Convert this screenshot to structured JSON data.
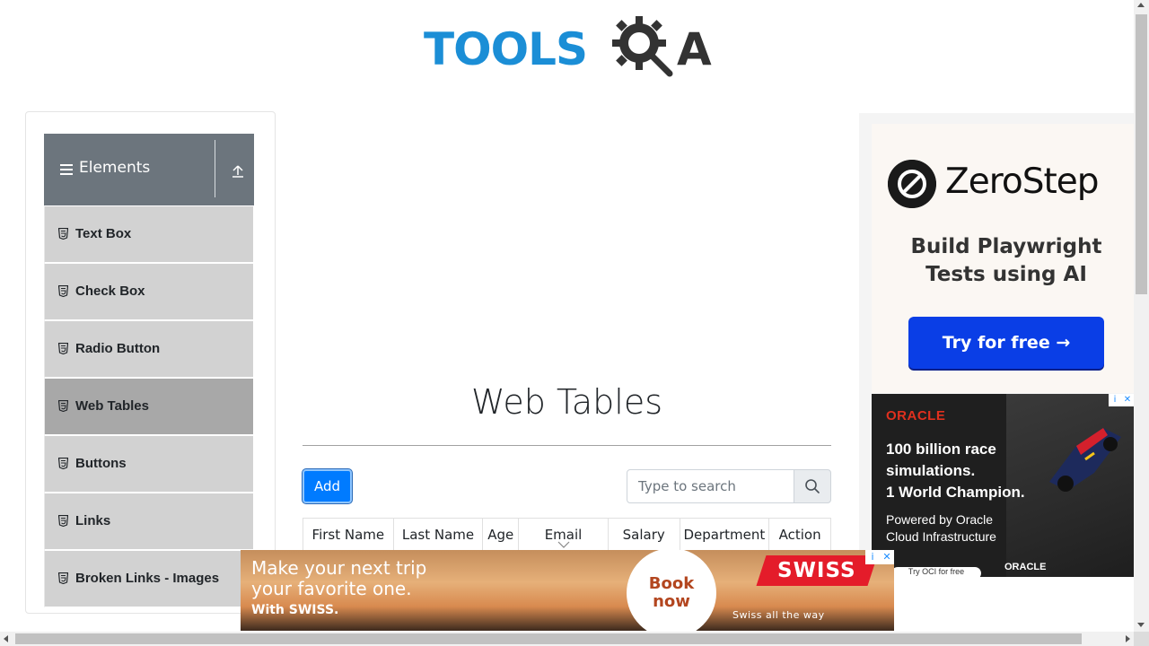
{
  "header": {
    "logo_text": "TOOLS",
    "logo_suffix": "A"
  },
  "sidebar": {
    "group_title": "Elements",
    "items": [
      {
        "label": "Text Box",
        "active": false
      },
      {
        "label": "Check Box",
        "active": false
      },
      {
        "label": "Radio Button",
        "active": false
      },
      {
        "label": "Web Tables",
        "active": true
      },
      {
        "label": "Buttons",
        "active": false
      },
      {
        "label": "Links",
        "active": false
      },
      {
        "label": "Broken Links - Images",
        "active": false
      }
    ]
  },
  "main": {
    "title": "Web Tables",
    "add_label": "Add",
    "search_placeholder": "Type to search",
    "columns": [
      "First Name",
      "Last Name",
      "Age",
      "Email",
      "Salary",
      "Department",
      "Action"
    ]
  },
  "ads": {
    "zerostep": {
      "brand": "ZeroStep",
      "headline_line1": "Build Playwright",
      "headline_line2": "Tests using AI",
      "cta": "Try for free →"
    },
    "oracle": {
      "brand": "ORACLE",
      "headline_line1": "100 billion race",
      "headline_line2": "simulations.",
      "headline_line3": "1 World Champion.",
      "sub_line1": "Powered by Oracle",
      "sub_line2": "Cloud Infrastructure",
      "cta": "Try OCI for free",
      "footer_brand": "ORACLE"
    },
    "swiss": {
      "line1": "Make your next trip",
      "line2": "your favorite one.",
      "small": "With SWISS.",
      "book_line1": "Book",
      "book_line2": "now",
      "logo": "SWISS",
      "tagline": "Swiss  all  the  way"
    }
  },
  "colors": {
    "brand_blue": "#1b8ed6",
    "primary_button": "#007bff",
    "sidebar_header": "#6c757d",
    "sidebar_item": "#d2d2d2",
    "sidebar_item_active": "#a8a8a8",
    "oracle_red": "#e0301e",
    "swiss_red": "#e41c2a"
  }
}
